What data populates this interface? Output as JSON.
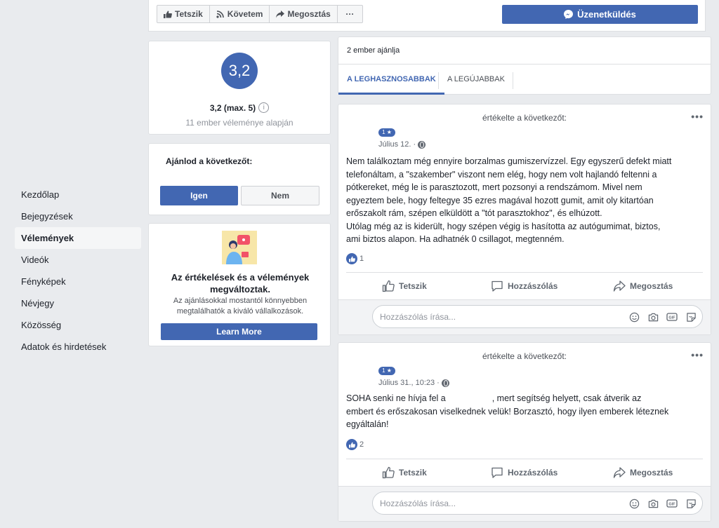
{
  "topbar": {
    "like_label": "Tetszik",
    "follow_label": "Követem",
    "share_label": "Megosztás",
    "more_label": "···",
    "message_label": "Üzenetküldés"
  },
  "nav": {
    "items": [
      {
        "label": "Kezdőlap"
      },
      {
        "label": "Bejegyzések"
      },
      {
        "label": "Vélemények"
      },
      {
        "label": "Videók"
      },
      {
        "label": "Fényképek"
      },
      {
        "label": "Névjegy"
      },
      {
        "label": "Közösség"
      },
      {
        "label": "Adatok és hirdetések"
      }
    ],
    "active_index": 2
  },
  "rating": {
    "score": "3,2",
    "score_text": "3,2 (max. 5)",
    "info_glyph": "i",
    "subtitle": "11 ember véleménye alapján"
  },
  "recommend": {
    "question": "Ajánlod a következőt:",
    "yes_label": "Igen",
    "no_label": "Nem"
  },
  "changed": {
    "title": "Az értékelések és a vélemények megváltoztak.",
    "body": "Az ajánlásokkal mostantól könnyebben megtalálhatók a kiváló vállalkozások.",
    "button_label": "Learn More"
  },
  "reviews_header": {
    "count_text": "2 ember ajánlja",
    "tabs": [
      {
        "label": "A LEGHASZNOSABBAK"
      },
      {
        "label": "A LEGÚJABBAK"
      }
    ],
    "active_tab": 0
  },
  "reviews": [
    {
      "header": "értékelte a következőt:",
      "more_label": "•••",
      "badge": "1 ★",
      "date": "Július 12. ·",
      "text_lines": [
        "Nem találkoztam még ennyire borzalmas gumiszervízzel. Egy egyszerű defekt miatt",
        "telefonáltam, a \"szakember\" viszont nem elég, hogy nem volt hajlandó feltenni a",
        "pótkereket, még le is parasztozott, mert pozsonyi a rendszámom. Mivel nem",
        "egyeztem bele, hogy feltegye 35 ezres magával hozott gumit, amit oly kitartóan",
        "erőszakolt rám, szépen elküldött a \"tót parasztokhoz\", és elhúzott.",
        "Utólag még az is kiderült, hogy szépen végig is hasította az autógumimat, biztos,",
        "ami biztos alapon. Ha adhatnék 0 csillagot, megtenném."
      ],
      "likes": "1",
      "actions": {
        "like": "Tetszik",
        "comment": "Hozzászólás",
        "share": "Megosztás"
      },
      "comment_placeholder": "Hozzászólás írása..."
    },
    {
      "header": "értékelte a következőt:",
      "more_label": "•••",
      "badge": "1 ★",
      "date": "Július 31., 10:23 ·",
      "text_lines": [
        "SOHA senki ne hívja fel a                   , mert segítség helyett, csak átverik az",
        "embert és erőszakosan viselkednek velük! Borzasztó, hogy ilyen emberek léteznek",
        "egyáltalán!"
      ],
      "likes": "2",
      "actions": {
        "like": "Tetszik",
        "comment": "Hozzászólás",
        "share": "Megosztás"
      },
      "comment_placeholder": "Hozzászólás írása..."
    }
  ],
  "colors": {
    "page_bg": "#e9ebee",
    "brand_blue": "#4267b2",
    "border": "#dddfe2",
    "muted_text": "#90949c"
  },
  "icons": {
    "like": "thumbs-up-icon",
    "follow": "rss-icon",
    "share": "share-arrow-icon",
    "messenger": "messenger-icon",
    "info": "info-icon",
    "globe": "globe-icon",
    "comment": "speech-bubble-icon",
    "emoji": "smiley-icon",
    "camera": "camera-icon",
    "gif": "gif-icon",
    "sticker": "sticker-icon"
  }
}
